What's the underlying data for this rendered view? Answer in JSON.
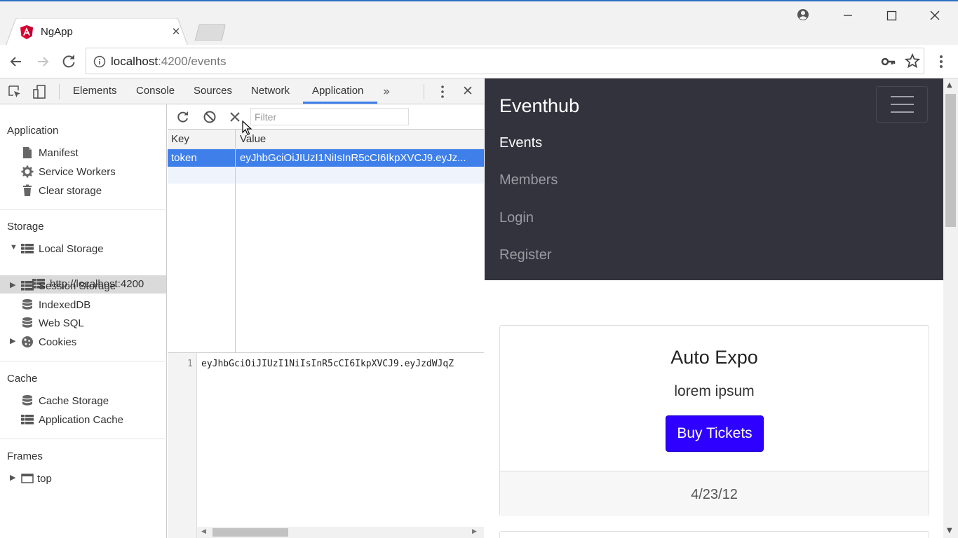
{
  "browser": {
    "tab_title": "NgApp",
    "tab_close": "✕",
    "url_host": "localhost",
    "url_rest": ":4200/events"
  },
  "devtools": {
    "tabs": [
      "Elements",
      "Console",
      "Sources",
      "Network",
      "Application"
    ],
    "active_tab": "Application",
    "more_tabs": "»",
    "close": "✕",
    "sidebar": {
      "application": {
        "heading": "Application",
        "items": [
          "Manifest",
          "Service Workers",
          "Clear storage"
        ]
      },
      "storage": {
        "heading": "Storage",
        "local_storage": "Local Storage",
        "local_origin": "http://localhost:4200",
        "session_storage": "Session Storage",
        "indexeddb": "IndexedDB",
        "websql": "Web SQL",
        "cookies": "Cookies"
      },
      "cache": {
        "heading": "Cache",
        "items": [
          "Cache Storage",
          "Application Cache"
        ]
      },
      "frames": {
        "heading": "Frames",
        "top": "top"
      }
    },
    "storage_panel": {
      "filter_placeholder": "Filter",
      "columns": [
        "Key",
        "Value"
      ],
      "rows": [
        {
          "key": "token",
          "value": "eyJhbGciOiJIUzI1NiIsInR5cCI6IkpXVCJ9.eyJz..."
        }
      ],
      "viewer_line_number": "1",
      "viewer_text": "eyJhbGciOiJIUzI1NiIsInR5cCI6IkpXVCJ9.eyJzdWJqZ"
    }
  },
  "page": {
    "brand": "Eventhub",
    "nav": [
      "Events",
      "Members",
      "Login",
      "Register"
    ],
    "active_nav": "Events",
    "card": {
      "title": "Auto Expo",
      "text": "lorem ipsum",
      "button": "Buy Tickets",
      "date": "4/23/12"
    }
  },
  "colors": {
    "devtools_accent": "#3e7fea",
    "navbar_bg": "#33333e",
    "buy_button": "#2d00ff"
  }
}
